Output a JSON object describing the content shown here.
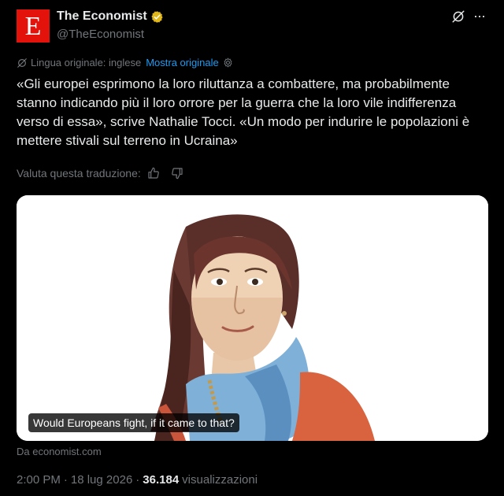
{
  "author": {
    "logo_letter": "E",
    "display_name": "The Economist",
    "handle": "@TheEconomist",
    "verified_icon": "verified-badge-icon",
    "brand_color": "#e3120b",
    "verified_color": "#e2b719"
  },
  "translation": {
    "original_language": "Lingua originale: inglese",
    "show_original": "Mostra originale",
    "rate_label": "Valuta questa traduzione:"
  },
  "tweet": {
    "text": "«Gli europei esprimono la loro riluttanza a combattere, ma probabilmente stanno indicando più il loro orrore per la guerra che la loro vile indifferenza verso di essa», scrive Nathalie Tocci. «Un modo per indurire le popolazioni è mettere stivali sul terreno in Ucraina»"
  },
  "card": {
    "caption": "Would Europeans fight, if it came to that?",
    "source": "Da economist.com"
  },
  "meta": {
    "time": "2:00 PM",
    "date": "18 lug 2026",
    "views_count": "36.184",
    "views_label": "visualizzazioni"
  },
  "accent_color": "#1d9bf0"
}
